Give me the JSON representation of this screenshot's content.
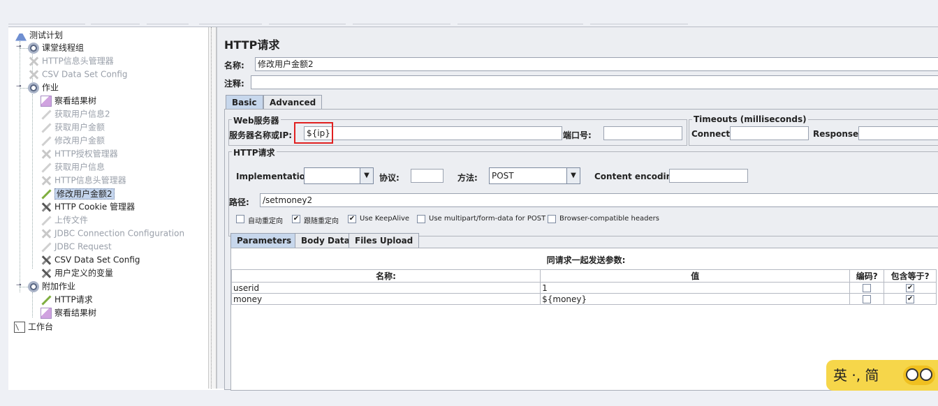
{
  "tree": {
    "items": [
      {
        "label": "测试计划",
        "icon": "flask-icon",
        "disabled": false
      },
      {
        "label": "课堂线程组",
        "icon": "gear-icon",
        "disabled": false
      },
      {
        "label": "HTTP信息头管理器",
        "icon": "cross-tool-icon",
        "disabled": true
      },
      {
        "label": "CSV Data Set Config",
        "icon": "cross-tool-icon",
        "disabled": true
      },
      {
        "label": "作业",
        "icon": "gear-icon",
        "disabled": false
      },
      {
        "label": "察看结果树",
        "icon": "chart-icon",
        "disabled": false
      },
      {
        "label": "获取用户信息2",
        "icon": "sampler-pen-icon",
        "disabled": true
      },
      {
        "label": "获取用户金额",
        "icon": "sampler-pen-icon",
        "disabled": true
      },
      {
        "label": "修改用户金额",
        "icon": "sampler-pen-icon",
        "disabled": true
      },
      {
        "label": "HTTP授权管理器",
        "icon": "cross-tool-icon",
        "disabled": true
      },
      {
        "label": "获取用户信息",
        "icon": "sampler-pen-icon",
        "disabled": true
      },
      {
        "label": "HTTP信息头管理器",
        "icon": "cross-tool-icon",
        "disabled": true
      },
      {
        "label": "修改用户金额2",
        "icon": "sampler-pen-icon",
        "disabled": false,
        "selected": true
      },
      {
        "label": "HTTP Cookie 管理器",
        "icon": "cross-tool-icon",
        "disabled": false
      },
      {
        "label": "上传文件",
        "icon": "sampler-pen-icon",
        "disabled": true
      },
      {
        "label": "JDBC Connection Configuration",
        "icon": "cross-tool-icon",
        "disabled": true
      },
      {
        "label": "JDBC Request",
        "icon": "sampler-pen-icon",
        "disabled": true
      },
      {
        "label": "CSV Data Set Config",
        "icon": "cross-tool-icon",
        "disabled": false
      },
      {
        "label": "用户定义的变量",
        "icon": "cross-tool-icon",
        "disabled": false
      },
      {
        "label": "附加作业",
        "icon": "gear-icon",
        "disabled": false
      },
      {
        "label": "HTTP请求",
        "icon": "sampler-pen-icon",
        "disabled": false
      },
      {
        "label": "察看结果树",
        "icon": "chart-icon",
        "disabled": false
      },
      {
        "label": "工作台",
        "icon": "workbench-icon",
        "disabled": false
      }
    ]
  },
  "panel": {
    "title": "HTTP请求",
    "name_label": "名称:",
    "name_value": "修改用户金额2",
    "comment_label": "注释:",
    "comment_value": "",
    "tabs": [
      "Basic",
      "Advanced"
    ],
    "web_server_legend": "Web服务器",
    "server_label": "服务器名称或IP:",
    "server_value": "${ip}",
    "port_label": "端口号:",
    "port_value": "",
    "timeouts_legend": "Timeouts (milliseconds)",
    "connect_label": "Connect:",
    "connect_value": "",
    "response_label": "Response:",
    "response_value": "",
    "http_legend": "HTTP请求",
    "impl_label": "Implementation:",
    "impl_value": "",
    "protocol_label": "协议:",
    "protocol_value": "",
    "method_label": "方法:",
    "method_value": "POST",
    "encoding_label": "Content encoding:",
    "encoding_value": "",
    "path_label": "路径:",
    "path_value": "/setmoney2",
    "options": [
      {
        "label": "自动重定向",
        "checked": false
      },
      {
        "label": "跟随重定向",
        "checked": true
      },
      {
        "label": "Use KeepAlive",
        "checked": true
      },
      {
        "label": "Use multipart/form-data for POST",
        "checked": false
      },
      {
        "label": "Browser-compatible headers",
        "checked": false
      }
    ],
    "param_tabs": [
      "Parameters",
      "Body Data",
      "Files Upload"
    ],
    "params_caption": "同请求一起发送参数:",
    "params_headers": [
      "名称:",
      "值",
      "编码?",
      "包含等于?"
    ],
    "params_rows": [
      {
        "name": "userid",
        "value": "1",
        "encode": false,
        "include_equals": true
      },
      {
        "name": "money",
        "value": "${money}",
        "encode": false,
        "include_equals": true
      }
    ]
  },
  "ime": {
    "text": "英 ·, 简"
  },
  "colors": {
    "accent": "#c7d7ec",
    "highlight_box": "#e02020",
    "ime_bg": "#f6d64a"
  }
}
